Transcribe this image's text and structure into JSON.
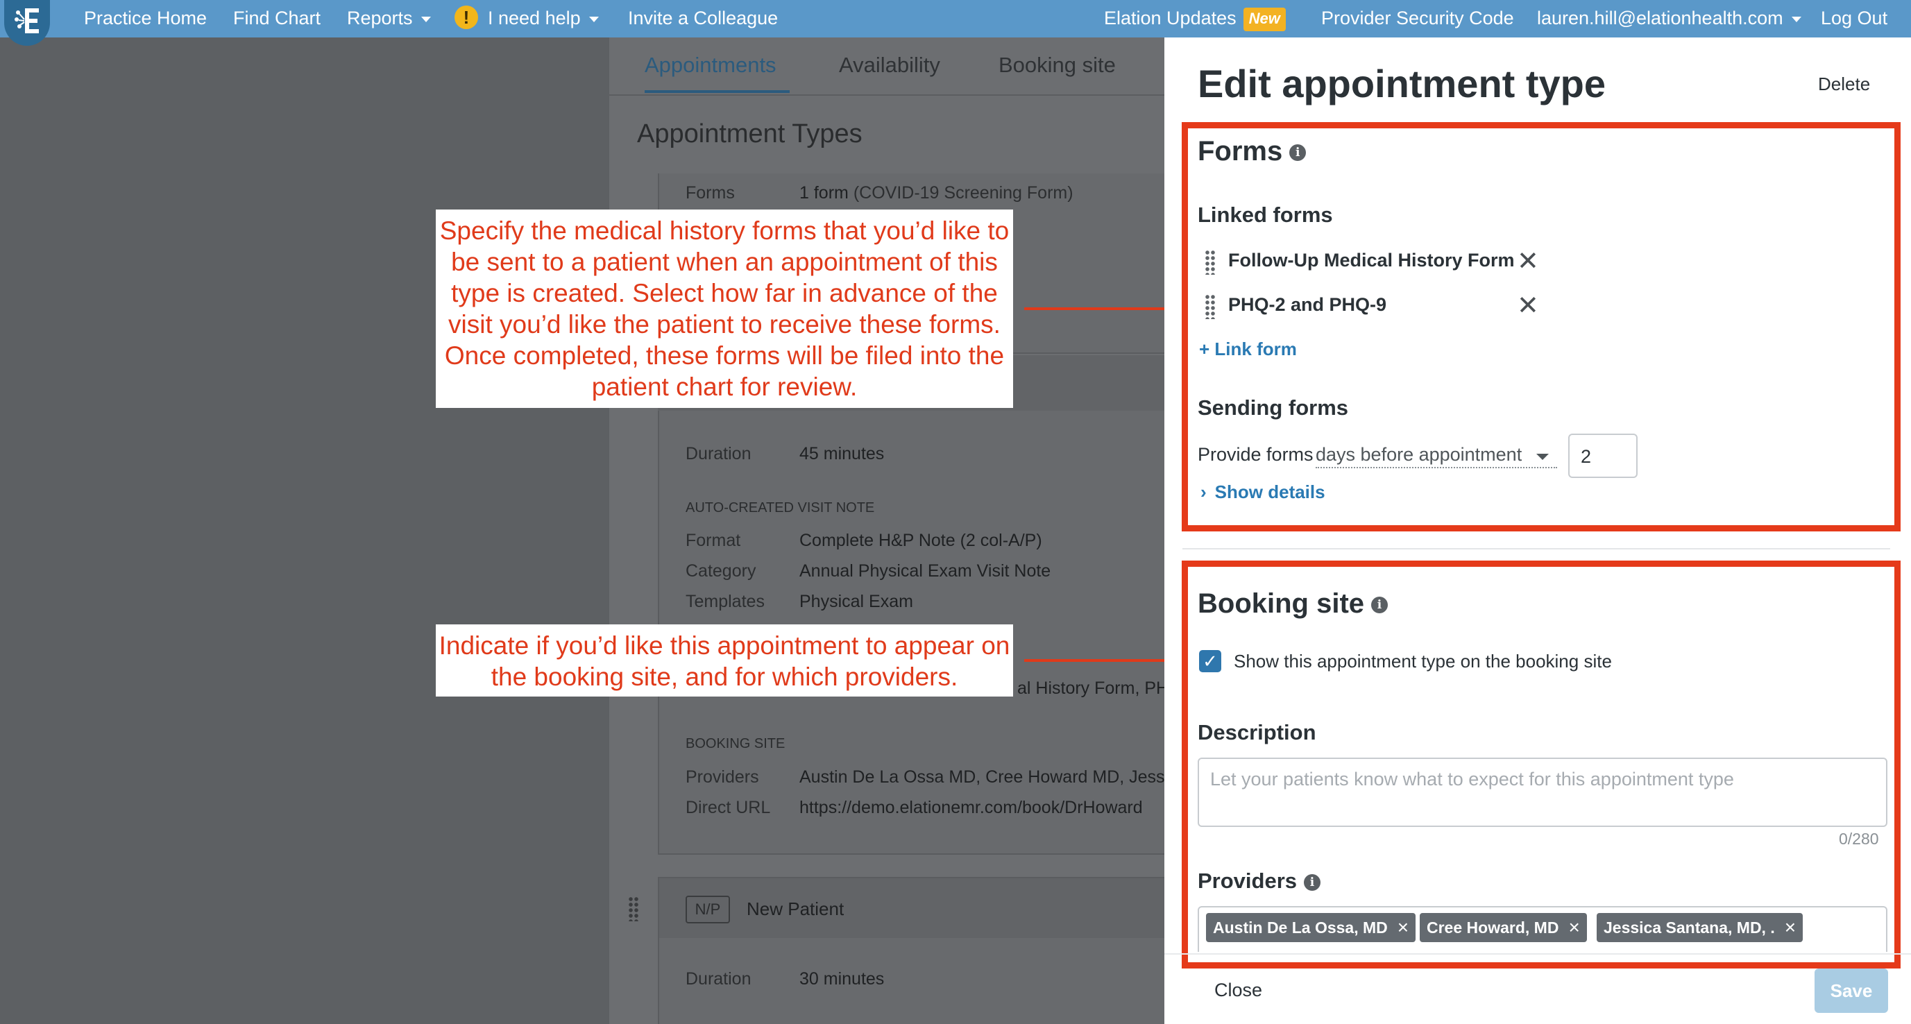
{
  "nav": {
    "practice_home": "Practice Home",
    "find_chart": "Find Chart",
    "reports": "Reports",
    "help": "I need help",
    "invite": "Invite a Colleague",
    "updates": "Elation Updates",
    "new_badge": "New",
    "security_code": "Provider Security Code",
    "user_email": "lauren.hill@elationhealth.com",
    "logout": "Log Out"
  },
  "background": {
    "tabs": [
      "Appointments",
      "Availability",
      "Booking site"
    ],
    "heading": "Appointment Types",
    "forms_label": "Forms",
    "forms_value": "1 form",
    "forms_value_detail": "(COVID-19 Screening Form)",
    "duration_label": "Duration",
    "duration_value": "45 minutes",
    "auto_note_section": "AUTO-CREATED VISIT NOTE",
    "format_label": "Format",
    "format_value": "Complete H&P Note (2 col-A/P)",
    "category_label": "Category",
    "category_value": "Annual Physical Exam Visit Note",
    "templates_label": "Templates",
    "templates_value": "Physical Exam",
    "forms_partial": "al History Form, PHQ",
    "booking_section": "BOOKING SITE",
    "providers_label": "Providers",
    "providers_value": "Austin De La Ossa MD, Cree Howard MD, Jess",
    "url_label": "Direct URL",
    "url_value": "https://demo.elationemr.com/book/DrHoward",
    "np_badge": "N/P",
    "new_patient": "New Patient",
    "duration2_label": "Duration",
    "duration2_value": "30 minutes"
  },
  "callouts": {
    "forms": "Specify the medical history forms that you’d like to be sent to a patient when an appointment of this type is created. Select how far in advance of the visit you’d like the patient to receive these forms. Once completed, these forms will be filed into the patient chart for review.",
    "booking": "Indicate if you’d like this appointment to appear on the booking site, and for which providers."
  },
  "drawer": {
    "title": "Edit appointment type",
    "delete": "Delete",
    "forms_title": "Forms",
    "linked_forms_title": "Linked forms",
    "linked_forms": [
      "Follow-Up Medical History Form",
      "PHQ-2 and PHQ-9"
    ],
    "link_form": "+ Link form",
    "sending_title": "Sending forms",
    "provide_label": "Provide forms",
    "days_option": "days before appointment",
    "days_value": "2",
    "show_details": "Show details",
    "booking_title": "Booking site",
    "show_on_booking": "Show this appointment type on the booking site",
    "description_title": "Description",
    "description_placeholder": "Let your patients know what to expect for this appointment type",
    "char_counter": "0/280",
    "providers_title": "Providers",
    "providers": [
      "Austin De La Ossa, MD",
      "Cree Howard, MD",
      "Jessica Santana, MD, ."
    ],
    "close": "Close",
    "save": "Save"
  },
  "colors": {
    "nav_bg": "#5a98c9",
    "annotation_red": "#e53a1a",
    "link_blue": "#2a7ab3",
    "checkbox_blue": "#2f77ad",
    "save_disabled": "#a9cce3"
  },
  "icons": [
    "elation-logo-icon",
    "warning-icon",
    "caret-down-icon",
    "info-icon",
    "drag-handle-icon",
    "close-icon",
    "plus-icon",
    "chevron-right-icon",
    "checkmark-icon",
    "arrow-right-icon"
  ]
}
